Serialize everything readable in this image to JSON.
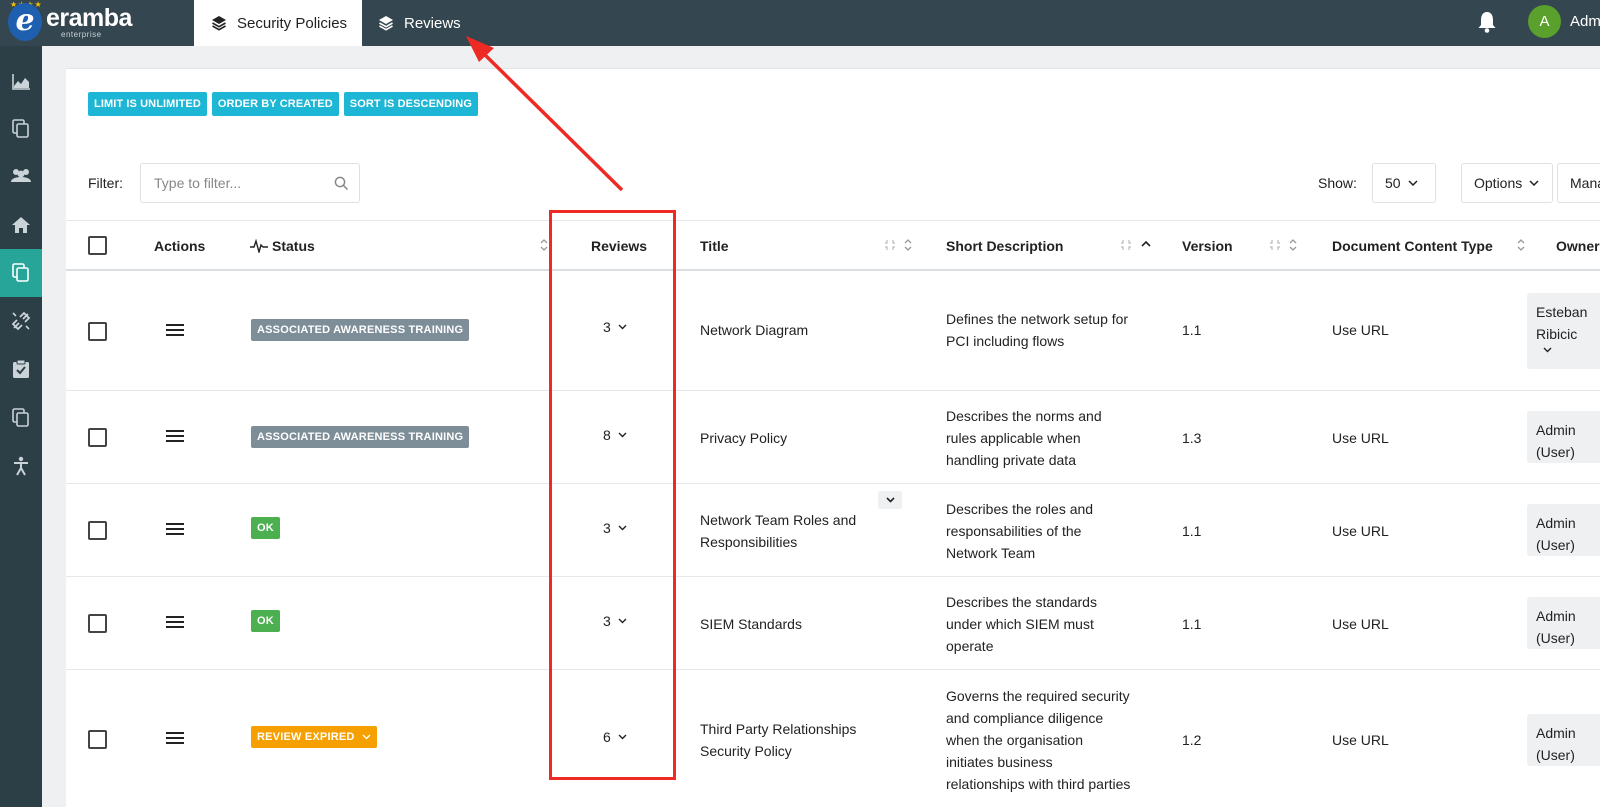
{
  "app": {
    "brand": "eramba",
    "brand_sub": "enterprise",
    "tabs": [
      {
        "label": "Security Policies",
        "active": true
      },
      {
        "label": "Reviews",
        "active": false
      }
    ],
    "user_initial": "A",
    "user_name": "Admin"
  },
  "badges": [
    "LIMIT IS UNLIMITED",
    "ORDER BY CREATED",
    "SORT IS DESCENDING"
  ],
  "toolbar": {
    "filter_label": "Filter:",
    "filter_placeholder": "Type to filter...",
    "show_label": "Show:",
    "show_value": "50",
    "options_label": "Options",
    "manage_label": "Manage"
  },
  "table": {
    "columns": [
      "Actions",
      "Status",
      "Reviews",
      "Title",
      "Short Description",
      "Version",
      "Document Content Type",
      "Owner"
    ],
    "rows": [
      {
        "status": "ASSOCIATED AWARENESS TRAINING",
        "status_color": "#7d8e98",
        "reviews": "3",
        "title": [
          "Network Diagram"
        ],
        "description": [
          "Defines the network setup for",
          "PCI including flows"
        ],
        "version": "1.1",
        "content_type": "Use URL",
        "owner": [
          "Esteban",
          "Ribicic"
        ]
      },
      {
        "status": "ASSOCIATED AWARENESS TRAINING",
        "status_color": "#7d8e98",
        "reviews": "8",
        "title": [
          "Privacy Policy"
        ],
        "description": [
          "Describes the norms and",
          "rules applicable when",
          "handling private data"
        ],
        "version": "1.3",
        "content_type": "Use URL",
        "owner": [
          "Admin",
          "(User)"
        ]
      },
      {
        "status": "OK",
        "status_color": "#4caf50",
        "reviews": "3",
        "title": [
          "Network Team Roles and",
          "Responsibilities"
        ],
        "description": [
          "Describes the roles and",
          "responsabilities of the",
          "Network Team"
        ],
        "version": "1.1",
        "content_type": "Use URL",
        "owner": [
          "Admin",
          "(User)"
        ]
      },
      {
        "status": "OK",
        "status_color": "#4caf50",
        "reviews": "3",
        "title": [
          "SIEM Standards"
        ],
        "description": [
          "Describes the standards",
          "under which SIEM must",
          "operate"
        ],
        "version": "1.1",
        "content_type": "Use URL",
        "owner": [
          "Admin",
          "(User)"
        ]
      },
      {
        "status": "REVIEW EXPIRED",
        "status_color": "#f5a000",
        "reviews": "6",
        "title": [
          "Third Party Relationships",
          "Security Policy"
        ],
        "description": [
          "Governs the required security",
          "and compliance diligence",
          "when the organisation",
          "initiates business",
          "relationships with third parties"
        ],
        "version": "1.2",
        "content_type": "Use URL",
        "owner": [
          "Admin",
          "(User)"
        ]
      }
    ]
  },
  "colors": {
    "topbar": "#34464f",
    "sidebar": "#2c3e46",
    "sidebar_active": "#27a598",
    "badge": "#1db6d4",
    "annotation": "#ee2a24"
  }
}
